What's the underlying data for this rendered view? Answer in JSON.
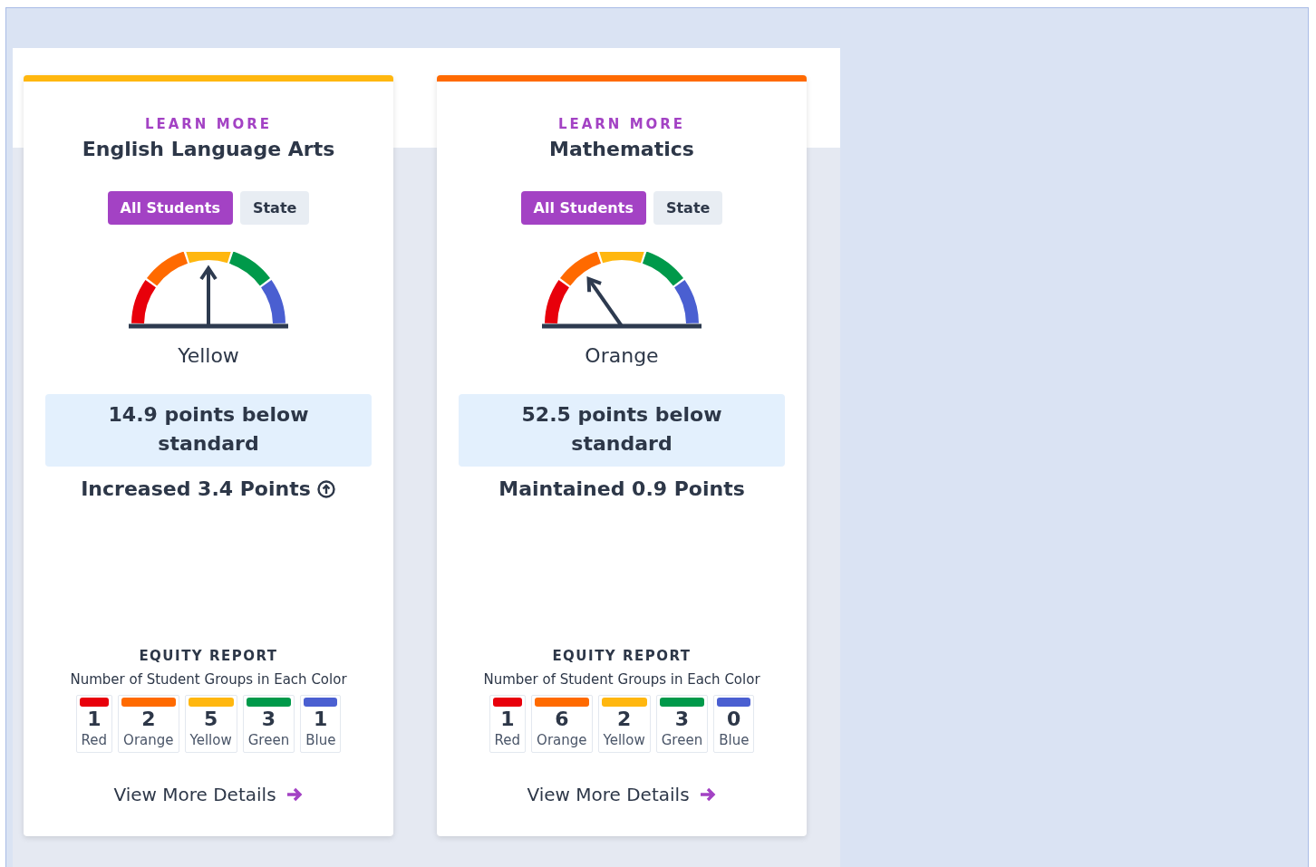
{
  "cards": [
    {
      "color": "#ffb70f",
      "link": "LEARN MORE",
      "title": "English Language Arts",
      "tabs": [
        {
          "label": "All Students",
          "selected": true
        },
        {
          "label": "State",
          "selected": false
        }
      ],
      "status": "Yellow",
      "score": "14.9 points below standard",
      "change": "Increased 3.4 Points",
      "kind": "increased",
      "equity": {
        "heading": "EQUITY REPORT",
        "subheading": "Number of Student Groups in Each Color",
        "counts": [
          {
            "count": "1",
            "label": "Red",
            "color": "#e8000b"
          },
          {
            "count": "2",
            "label": "Orange",
            "color": "#ff6a00"
          },
          {
            "count": "5",
            "label": "Yellow",
            "color": "#ffb70f"
          },
          {
            "count": "3",
            "label": "Green",
            "color": "#00994a"
          },
          {
            "count": "1",
            "label": "Blue",
            "color": "#4a5fd1"
          }
        ]
      },
      "details": "View More Details"
    },
    {
      "color": "#ff6a00",
      "link": "LEARN MORE",
      "title": "Mathematics",
      "tabs": [
        {
          "label": "All Students",
          "selected": true
        },
        {
          "label": "State",
          "selected": false
        }
      ],
      "status": "Orange",
      "score": "52.5 points below standard",
      "change": "Maintained 0.9 Points",
      "kind": "maintained",
      "equity": {
        "heading": "EQUITY REPORT",
        "subheading": "Number of Student Groups in Each Color",
        "counts": [
          {
            "count": "1",
            "label": "Red",
            "color": "#e8000b"
          },
          {
            "count": "6",
            "label": "Orange",
            "color": "#ff6a00"
          },
          {
            "count": "2",
            "label": "Yellow",
            "color": "#ffb70f"
          },
          {
            "count": "3",
            "label": "Green",
            "color": "#00994a"
          },
          {
            "count": "0",
            "label": "Blue",
            "color": "#4a5fd1"
          }
        ]
      },
      "details": "View More Details"
    }
  ]
}
